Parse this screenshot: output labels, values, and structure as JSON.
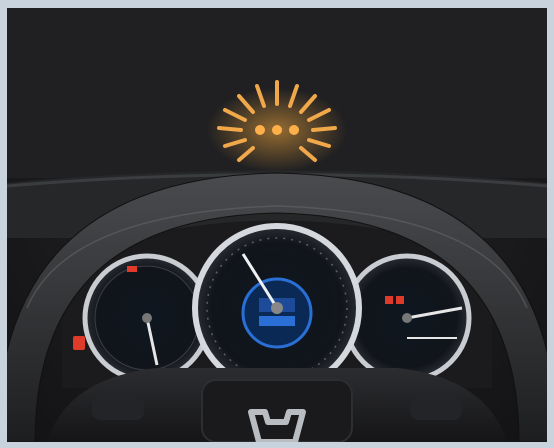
{
  "scene": {
    "description_visible_text": "H",
    "colors": {
      "frame": "#c9d3dd",
      "dashboard": "#1c1c1e",
      "amber_light": "#f2a33a",
      "speedo_blue": "#2a6fd6",
      "warning_red": "#e03a2a"
    },
    "icons": {
      "alert": "collision-warning-icon",
      "logo": "honda-logo-icon"
    }
  }
}
